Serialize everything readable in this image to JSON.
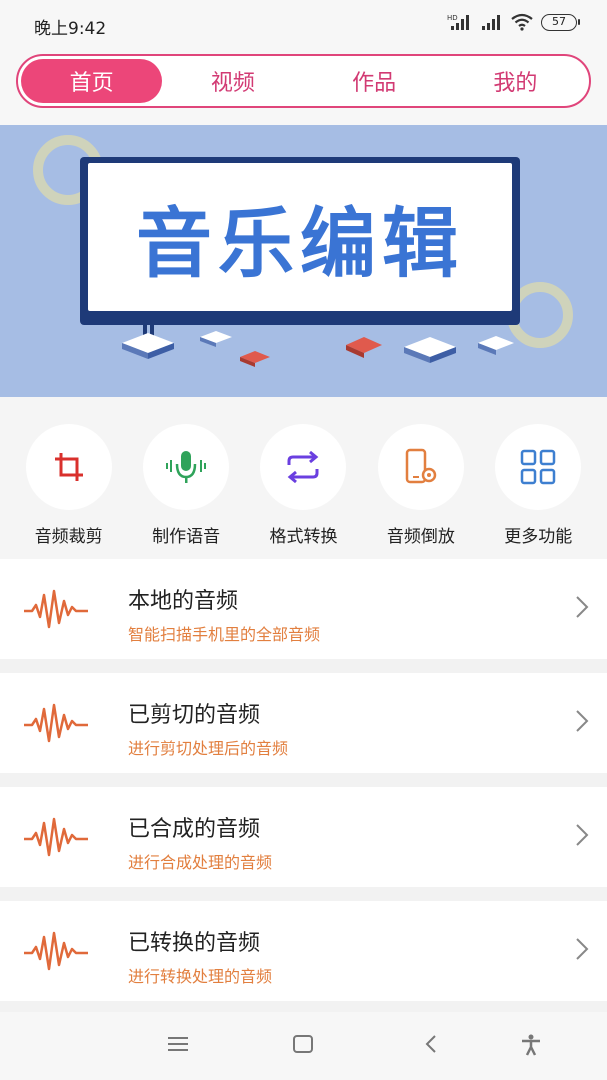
{
  "status_bar": {
    "time": "晚上9:42",
    "battery": "57"
  },
  "nav": {
    "tabs": [
      {
        "label": "首页",
        "active": true
      },
      {
        "label": "视频",
        "active": false
      },
      {
        "label": "作品",
        "active": false
      },
      {
        "label": "我的",
        "active": false
      }
    ]
  },
  "banner": {
    "title": "音乐编辑"
  },
  "tools": [
    {
      "label": "音频裁剪",
      "icon": "crop-icon"
    },
    {
      "label": "制作语音",
      "icon": "microphone-icon"
    },
    {
      "label": "格式转换",
      "icon": "convert-icon"
    },
    {
      "label": "音频倒放",
      "icon": "phone-settings-icon"
    },
    {
      "label": "更多功能",
      "icon": "grid-icon"
    }
  ],
  "list": [
    {
      "title": "本地的音频",
      "subtitle": "智能扫描手机里的全部音频"
    },
    {
      "title": "已剪切的音频",
      "subtitle": "进行剪切处理后的音频"
    },
    {
      "title": "已合成的音频",
      "subtitle": "进行合成处理的音频"
    },
    {
      "title": "已转换的音频",
      "subtitle": "进行转换处理的音频"
    }
  ],
  "colors": {
    "accent": "#ec4679",
    "banner_bg": "#a6bde4",
    "subtitle": "#e27f3f",
    "wave": "#e0693a"
  }
}
